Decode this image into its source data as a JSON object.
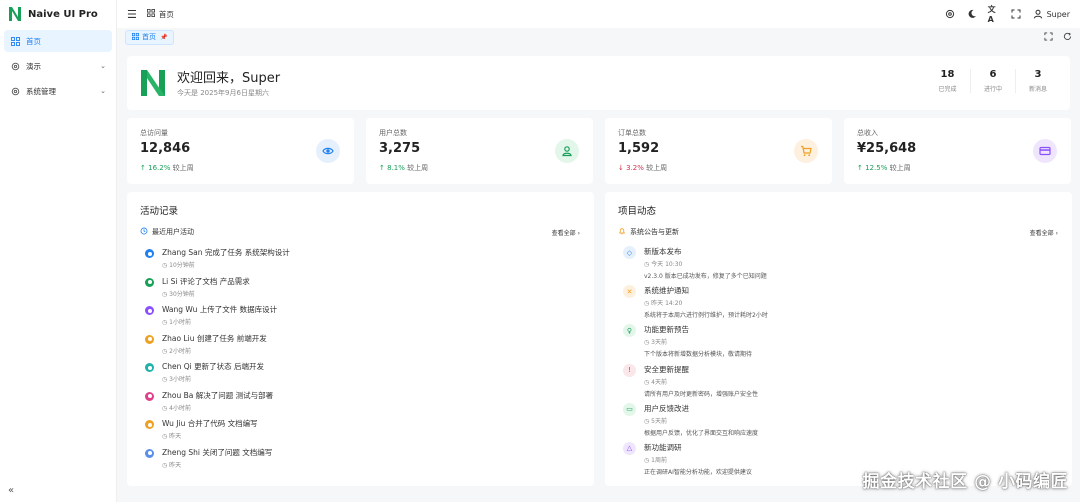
{
  "app": {
    "title": "Naive UI Pro",
    "brand_color": "#18a058"
  },
  "sidebar": {
    "items": [
      {
        "label": "首页",
        "icon": "dashboard-icon",
        "active": true
      },
      {
        "label": "演示",
        "icon": "gear-icon",
        "expandable": true
      },
      {
        "label": "系统管理",
        "icon": "gear-icon",
        "expandable": true
      }
    ],
    "collapse_icon": "double-chevron-left-icon"
  },
  "header": {
    "breadcrumb": "首页",
    "user": "Super",
    "icons": [
      "settings-icon",
      "moon-icon",
      "translate-icon",
      "fullscreen-icon",
      "user-icon"
    ]
  },
  "tabs": [
    {
      "label": "首页",
      "pinned": true
    }
  ],
  "welcome": {
    "title": "欢迎回来，Super",
    "subtitle": "今天是 2025年9月6日星期六",
    "stats": [
      {
        "value": "18",
        "label": "已完成"
      },
      {
        "value": "6",
        "label": "进行中"
      },
      {
        "value": "3",
        "label": "新消息"
      }
    ]
  },
  "stats": [
    {
      "label": "总访问量",
      "value": "12,846",
      "trend": "16.2%",
      "direction": "up",
      "compare": "较上周",
      "icon": "eye-icon",
      "color": "#2080f0",
      "bg": "#e6f0fc"
    },
    {
      "label": "用户总数",
      "value": "3,275",
      "trend": "8.1%",
      "direction": "up",
      "compare": "较上周",
      "icon": "user-icon",
      "color": "#18a058",
      "bg": "#e3f6ea"
    },
    {
      "label": "订单总数",
      "value": "1,592",
      "trend": "3.2%",
      "direction": "down",
      "compare": "较上周",
      "icon": "cart-icon",
      "color": "#f0a020",
      "bg": "#fdf0df"
    },
    {
      "label": "总收入",
      "value": "¥25,648",
      "trend": "12.5%",
      "direction": "up",
      "compare": "较上周",
      "icon": "card-icon",
      "color": "#8a4fff",
      "bg": "#efe6fd"
    }
  ],
  "activity": {
    "title": "活动记录",
    "subtitle": "最近用户活动",
    "more": "查看全部",
    "items": [
      {
        "text": "Zhang San 完成了任务 系统架构设计",
        "time": "10分钟前",
        "color": "#2080f0"
      },
      {
        "text": "Li Si 评论了文档 产品需求",
        "time": "30分钟前",
        "color": "#18a058"
      },
      {
        "text": "Wang Wu 上传了文件 数据库设计",
        "time": "1小时前",
        "color": "#8a4fff"
      },
      {
        "text": "Zhao Liu 创建了任务 前端开发",
        "time": "2小时前",
        "color": "#f0a020"
      },
      {
        "text": "Chen Qi 更新了状态 后端开发",
        "time": "3小时前",
        "color": "#20b2aa"
      },
      {
        "text": "Zhou Ba 解决了问题 测试与部署",
        "time": "4小时前",
        "color": "#e0408a"
      },
      {
        "text": "Wu Jiu 合并了代码 文档编写",
        "time": "昨天",
        "color": "#f0a020"
      },
      {
        "text": "Zheng Shi 关闭了问题 文档编写",
        "time": "昨天",
        "color": "#5a8ee8"
      }
    ]
  },
  "project": {
    "title": "项目动态",
    "subtitle": "系统公告与更新",
    "more": "查看全部",
    "items": [
      {
        "title": "新版本发布",
        "time": "今天 10:30",
        "desc": "v2.3.0 版本已成功发布，修复了多个已知问题",
        "icon": "tag-icon",
        "color": "#2080f0",
        "bg": "#e6f0fc"
      },
      {
        "title": "系统维护通知",
        "time": "昨天 14:20",
        "desc": "系统将于本周六进行例行维护，预计耗时2小时",
        "icon": "tools-icon",
        "color": "#f0a020",
        "bg": "#fdf0df"
      },
      {
        "title": "功能更新预告",
        "time": "3天前",
        "desc": "下个版本将新增数据分析模块，敬请期待",
        "icon": "bulb-icon",
        "color": "#18a058",
        "bg": "#e3f6ea"
      },
      {
        "title": "安全更新提醒",
        "time": "4天前",
        "desc": "请所有用户及时更新密码，增强账户安全性",
        "icon": "alert-icon",
        "color": "#d03050",
        "bg": "#fbe6ea"
      },
      {
        "title": "用户反馈改进",
        "time": "5天前",
        "desc": "根据用户反馈，优化了界面交互和响应速度",
        "icon": "chat-icon",
        "color": "#18a058",
        "bg": "#e3f6ea"
      },
      {
        "title": "新功能调研",
        "time": "1周前",
        "desc": "正在调研AI智能分析功能，欢迎提供建议",
        "icon": "flask-icon",
        "color": "#8a4fff",
        "bg": "#efe6fd"
      }
    ]
  },
  "watermark": "掘金技术社区 @ 小码编匠"
}
